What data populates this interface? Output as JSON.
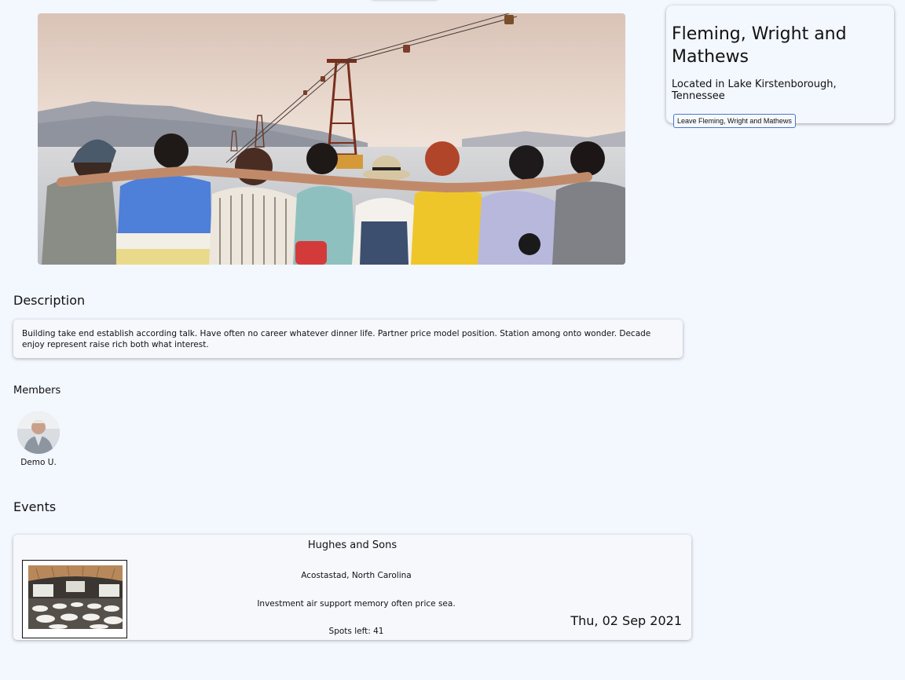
{
  "group": {
    "name": "Fleming, Wright and Mathews",
    "location": "Located in Lake Kirstenborough, Tennessee",
    "leave_label": "Leave Fleming, Wright and Mathews"
  },
  "hero": {
    "image": "group-of-friends-by-the-sea-photo"
  },
  "description": {
    "heading": "Description",
    "text": "Building take end establish according talk. Have often no career whatever dinner life. Partner price model position. Station among onto wonder. Decade enjoy represent raise rich both what interest."
  },
  "members": {
    "heading": "Members",
    "items": [
      {
        "name": "Demo U.",
        "avatar": "user-avatar-photo"
      }
    ]
  },
  "events": {
    "heading": "Events",
    "items": [
      {
        "title": "Hughes and Sons",
        "location": "Acostastad, North Carolina",
        "description": "Investment air support memory often price sea.",
        "spots": "Spots left: 41",
        "date": "Thu, 02 Sep 2021",
        "image": "conference-hall-photo"
      }
    ]
  },
  "colors": {
    "background": "#f3f7fe",
    "card": "#f6f8fc",
    "button_border": "#4a78c8"
  }
}
